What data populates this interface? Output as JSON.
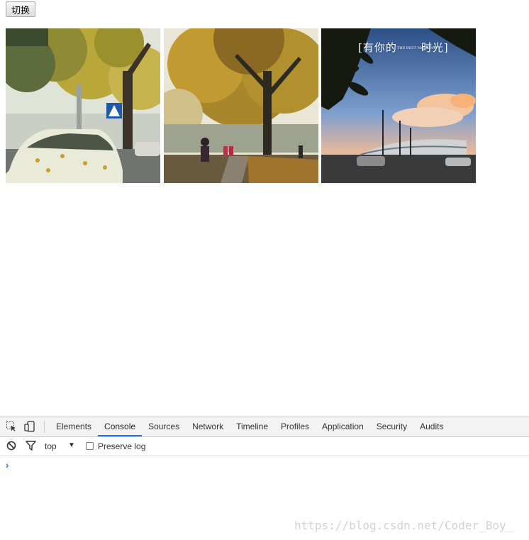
{
  "page": {
    "toggle_button_label": "切换"
  },
  "photos": [
    {
      "name": "tree-street-car-photo"
    },
    {
      "name": "autumn-park-path-photo"
    },
    {
      "name": "sunset-stadium-photo",
      "caption_main": "[有你的",
      "caption_small": "THE BEST MOMENT",
      "caption_end": "时光]"
    }
  ],
  "devtools": {
    "tabs": [
      "Elements",
      "Console",
      "Sources",
      "Network",
      "Timeline",
      "Profiles",
      "Application",
      "Security",
      "Audits"
    ],
    "active_tab": "Console",
    "context": "top",
    "preserve_log_label": "Preserve log",
    "prompt_symbol": "›",
    "accent_color": "#1a73e8"
  },
  "watermark": "https://blog.csdn.net/Coder_Boy_"
}
